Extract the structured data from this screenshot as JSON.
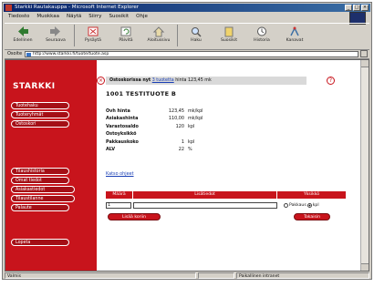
{
  "window": {
    "title": "Starkki Rautakauppa - Microsoft Internet Explorer"
  },
  "menu": [
    "Tiedosto",
    "Muokkaa",
    "Näytä",
    "Siirry",
    "Suosikit",
    "Ohje"
  ],
  "toolbar": [
    {
      "label": "Edellinen",
      "icon": "back-icon"
    },
    {
      "label": "Seuraava",
      "icon": "forward-icon"
    },
    {
      "label": "Pysäytä",
      "icon": "stop-icon"
    },
    {
      "label": "Päivitä",
      "icon": "refresh-icon"
    },
    {
      "label": "Aloitussivu",
      "icon": "home-icon"
    },
    {
      "label": "Haku",
      "icon": "search-icon"
    },
    {
      "label": "Suosikit",
      "icon": "favorites-icon"
    },
    {
      "label": "Historia",
      "icon": "history-icon"
    },
    {
      "label": "Kanavat",
      "icon": "channels-icon"
    }
  ],
  "address": {
    "label": "Osoite",
    "url": "http://www.starkki.fi/tuote/tuote.asp"
  },
  "sidebar": {
    "logo": "STARKKI",
    "items": [
      "Tuotehaku",
      "Tuoteryhmät",
      "Ostoskori",
      "Tilaushistoria",
      "Omat tiedot",
      "Asiakastiedot",
      "Tilaustilanne",
      "Palaute",
      "Lopeta"
    ]
  },
  "infobar": {
    "label": "Ostoskorissa nyt",
    "count": "3 tuotetta",
    "total": "hinta 123,45 mk"
  },
  "product": {
    "title": "1001 TESTITUOTE B",
    "rows": [
      {
        "key": "Ovh hinta",
        "value": "123,45",
        "unit": "mk/kpl"
      },
      {
        "key": "Asiakashinta",
        "value": "110,00",
        "unit": "mk/kpl"
      },
      {
        "key": "Varastosaldo",
        "value": "120",
        "unit": "kpl"
      },
      {
        "key": "Ostoyksikkö",
        "value": "",
        "unit": ""
      },
      {
        "key": "Pakkauskoko",
        "value": "1",
        "unit": "kpl"
      },
      {
        "key": "ALV",
        "value": "22",
        "unit": "%"
      }
    ],
    "link": "Katso ohjeet"
  },
  "order_table": {
    "headers": [
      "Määrä",
      "Lisätiedot",
      "Yksikkö"
    ],
    "qty_value": "1",
    "info_value": "",
    "radio_labels": [
      "Pakkaus",
      "kpl"
    ]
  },
  "buttons": {
    "left": "Lisää koriin",
    "right": "Takaisin"
  },
  "status": {
    "text": "Valmis",
    "zone": "Paikallinen intranet"
  },
  "colors": {
    "accent": "#c8141c",
    "titlebar": "#0a246a"
  }
}
